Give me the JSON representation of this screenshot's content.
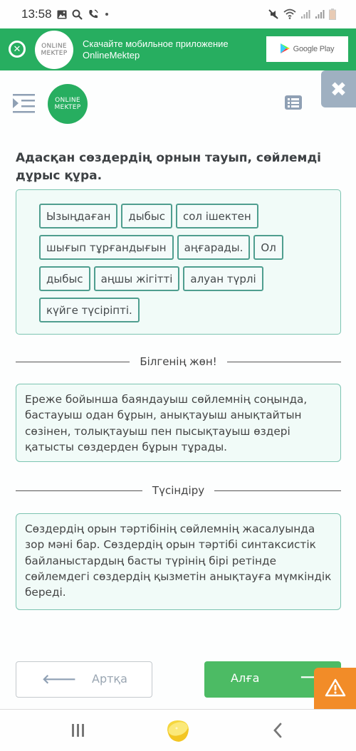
{
  "status_bar": {
    "time": "13:58",
    "left_icons": [
      "image-icon",
      "search-icon",
      "wifi-call-icon",
      "dot-icon"
    ],
    "right_icons": [
      "mute-icon",
      "wifi-icon",
      "signal-icon",
      "signal-icon",
      "battery-icon"
    ]
  },
  "app_banner": {
    "close_icon": "close-circle-icon",
    "logo_line1": "ONLINE",
    "logo_line2": "MEKTEP",
    "line1": "Скачайте мобильное приложение",
    "line2": "OnlineMektep",
    "store_label": "Google Play",
    "color": "#27ae60"
  },
  "header": {
    "menu_icon": "menu-indent-icon",
    "logo_line1": "ONLINE",
    "logo_line2": "MEKTEP",
    "list_icon": "list-icon",
    "close_icon": "close-icon"
  },
  "question": {
    "title": "Адасқан сөздердің орнын тауып, сөйлемді дұрыс құра."
  },
  "word_rows": [
    [
      "Ызыңдаған",
      "дыбыс",
      "сол ішектен"
    ],
    [
      "шығып тұрғандығын",
      "аңғарады.",
      "Ол"
    ],
    [
      "дыбыс",
      "аңшы жігітті",
      "алуан түрлі"
    ],
    [
      "күйге түсіріпті."
    ]
  ],
  "hint": {
    "heading": "Білгенің жөн!",
    "text": "Ереже бойынша баяндауыш сөйлемнің соңында, бастауыш одан бұрын, анықтауыш анықтайтын сөзінен, толықтауыш пен пысықтауыш өздері қатысты сөздерден бұрын тұрады."
  },
  "explanation": {
    "heading": "Түсіндіру",
    "text": "Сөздердің орын тәртібінің сөйлемнің жасалуында зор мәні бар. Сөздердің орын тәртібі синтаксистік байланыстардың басты түрінің бірі ретінде сөйлемдегі сөздердің қызметін анықтауға мүмкіндік береді."
  },
  "navigation": {
    "back_label": "Артқа",
    "next_label": "Алға",
    "back_icon": "arrow-left-icon",
    "next_icon": "arrow-right-icon",
    "warning_icon": "warning-icon",
    "next_color": "#4cbb64",
    "warning_color": "#f28c28"
  },
  "android_nav": {
    "recent": "recent-apps-icon",
    "home": "home-lemon-icon",
    "back": "back-icon"
  }
}
